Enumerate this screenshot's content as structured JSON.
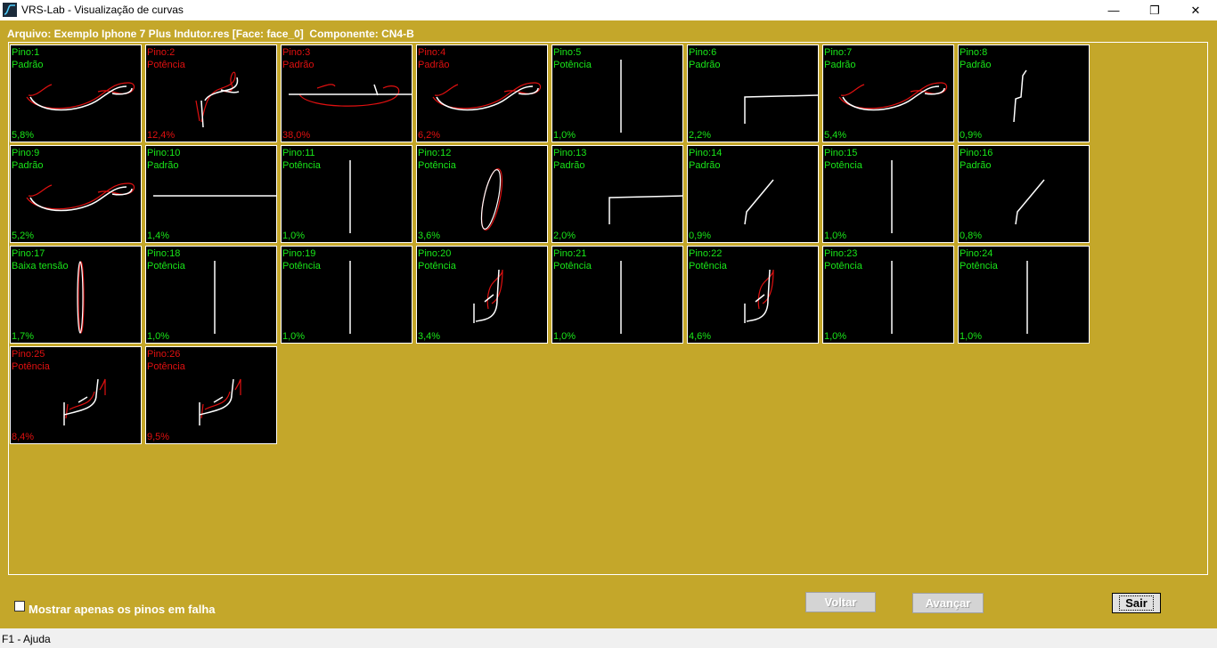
{
  "window": {
    "title": "VRS-Lab - Visualização de curvas",
    "min_symbol": "—",
    "max_symbol": "❐",
    "close_symbol": "✕"
  },
  "header": {
    "file_label": "Arquivo: Exemplo Iphone 7 Plus Indutor.res [Face: face_0]  Componente: CN4-B"
  },
  "colors": {
    "ok": "#19e619",
    "fail": "#e01010",
    "background": "#c4a72a",
    "curve_reference": "#e01010",
    "curve_measured": "#ffffff"
  },
  "pins": [
    {
      "label": "Pino:1",
      "mode": "Padrão",
      "pct": "5,8%",
      "status": "ok",
      "curve": "snake"
    },
    {
      "label": "Pino:2",
      "mode": "Potência",
      "pct": "12,4%",
      "status": "fail",
      "curve": "hook"
    },
    {
      "label": "Pino:3",
      "mode": "Padrão",
      "pct": "38,0%",
      "status": "fail",
      "curve": "flat_loop"
    },
    {
      "label": "Pino:4",
      "mode": "Padrão",
      "pct": "6,2%",
      "status": "fail",
      "curve": "snake"
    },
    {
      "label": "Pino:5",
      "mode": "Potência",
      "pct": "1,0%",
      "status": "ok",
      "curve": "vline"
    },
    {
      "label": "Pino:6",
      "mode": "Padrão",
      "pct": "2,2%",
      "status": "ok",
      "curve": "elbow"
    },
    {
      "label": "Pino:7",
      "mode": "Padrão",
      "pct": "5,4%",
      "status": "ok",
      "curve": "snake"
    },
    {
      "label": "Pino:8",
      "mode": "Padrão",
      "pct": "0,9%",
      "status": "ok",
      "curve": "step"
    },
    {
      "label": "Pino:9",
      "mode": "Padrão",
      "pct": "5,2%",
      "status": "ok",
      "curve": "snake"
    },
    {
      "label": "Pino:10",
      "mode": "Padrão",
      "pct": "1,4%",
      "status": "ok",
      "curve": "hline"
    },
    {
      "label": "Pino:11",
      "mode": "Potência",
      "pct": "1,0%",
      "status": "ok",
      "curve": "vline"
    },
    {
      "label": "Pino:12",
      "mode": "Potência",
      "pct": "3,6%",
      "status": "ok",
      "curve": "oval"
    },
    {
      "label": "Pino:13",
      "mode": "Padrão",
      "pct": "2,0%",
      "status": "ok",
      "curve": "elbow"
    },
    {
      "label": "Pino:14",
      "mode": "Padrão",
      "pct": "0,9%",
      "status": "ok",
      "curve": "diag"
    },
    {
      "label": "Pino:15",
      "mode": "Potência",
      "pct": "1,0%",
      "status": "ok",
      "curve": "vline"
    },
    {
      "label": "Pino:16",
      "mode": "Padrão",
      "pct": "0,8%",
      "status": "ok",
      "curve": "diag"
    },
    {
      "label": "Pino:17",
      "mode": "Baixa tensão",
      "pct": "1,7%",
      "status": "ok",
      "curve": "narrow_oval"
    },
    {
      "label": "Pino:18",
      "mode": "Potência",
      "pct": "1,0%",
      "status": "ok",
      "curve": "vline"
    },
    {
      "label": "Pino:19",
      "mode": "Potência",
      "pct": "1,0%",
      "status": "ok",
      "curve": "vline"
    },
    {
      "label": "Pino:20",
      "mode": "Potência",
      "pct": "3,4%",
      "status": "ok",
      "curve": "hook_small"
    },
    {
      "label": "Pino:21",
      "mode": "Potência",
      "pct": "1,0%",
      "status": "ok",
      "curve": "vline"
    },
    {
      "label": "Pino:22",
      "mode": "Potência",
      "pct": "4,6%",
      "status": "ok",
      "curve": "hook_small"
    },
    {
      "label": "Pino:23",
      "mode": "Potência",
      "pct": "1,0%",
      "status": "ok",
      "curve": "vline"
    },
    {
      "label": "Pino:24",
      "mode": "Potência",
      "pct": "1,0%",
      "status": "ok",
      "curve": "vline"
    },
    {
      "label": "Pino:25",
      "mode": "Potência",
      "pct": "8,4%",
      "status": "fail",
      "curve": "hook_low"
    },
    {
      "label": "Pino:26",
      "mode": "Potência",
      "pct": "9,5%",
      "status": "fail",
      "curve": "hook_low"
    }
  ],
  "checkbox": {
    "label": "Mostrar apenas os pinos em falha",
    "checked": false
  },
  "buttons": {
    "voltar": "Voltar",
    "avancar": "Avançar",
    "sair": "Sair"
  },
  "status_bar": {
    "text": "F1 - Ajuda"
  }
}
